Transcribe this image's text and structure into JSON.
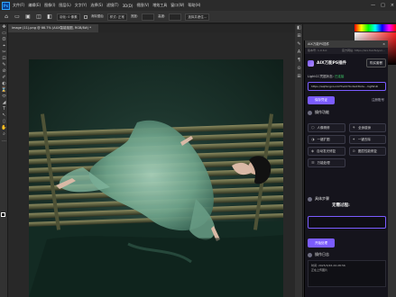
{
  "app": {
    "menu": [
      "文件(F)",
      "编辑(E)",
      "图像(I)",
      "图层(L)",
      "文字(Y)",
      "选择(S)",
      "滤镜(T)",
      "3D(D)",
      "视图(V)",
      "增效工具",
      "窗口(W)",
      "帮助(H)"
    ],
    "window_controls": [
      "—",
      "□",
      "×"
    ]
  },
  "options_bar": {
    "icons": [
      "⌂",
      "▭",
      "▣",
      "◫",
      "◧"
    ],
    "feather_label": "羽化: 0 像素",
    "antialias_label": "消除锯齿",
    "style_label": "样式: 正常",
    "width_label": "宽度:",
    "height_label": "高度:",
    "select_mask_label": "选择并遮住..."
  },
  "document_tab": {
    "title": "image (11).png @ 66.7% (AUX智能抠图, RGB/8#) *"
  },
  "toolbar": {
    "tools": [
      "✥",
      "▭",
      "ʘ",
      "⌖",
      "✂",
      "⊡",
      "✎",
      "⊘",
      "✐",
      "◐",
      "⌛",
      "⬭",
      "◢",
      "T",
      "↖",
      "▯",
      "✋",
      "⌕",
      "…"
    ]
  },
  "dock_icons": [
    "◧",
    "⊞",
    "✎",
    "A",
    "¶",
    "⊙",
    "⊞"
  ],
  "plugin": {
    "title": "AIX万能PS插件",
    "close": "×",
    "version_label": "版本号: 1.0.6.0",
    "website": "官方网站: https://aix.tianfeiyun...",
    "brand_name": "AIX万能PS插件",
    "purchase_button": "购买套餐",
    "credential_label": "LightCC凭据状态: ",
    "credential_status": "已连接",
    "credential_value": "https://aiqfengxiu.lzcf7edd7bc4a23b2a...mgf9n4l",
    "save_button": "保存凭证",
    "register_link": "注册账号",
    "features_title": "操作功能",
    "features": [
      {
        "icon": "⬡",
        "label": "人像精修"
      },
      {
        "icon": "⚘",
        "label": "全身瘦身"
      },
      {
        "icon": "◑",
        "label": "一键扩图"
      },
      {
        "icon": "✦",
        "label": "一键去除"
      },
      {
        "icon": "◈",
        "label": "自动发光修复"
      },
      {
        "icon": "⊙",
        "label": "图层性能修复"
      },
      {
        "icon": "☰",
        "label": "万能处理"
      }
    ],
    "steps_title": "具体步骤",
    "no_steps": "无需过程:",
    "start_button": "开始处理",
    "log_title": "操作日志",
    "log_lines": [
      "时间: 2025/3/26 20:28:56",
      "正在上传图片"
    ]
  },
  "colors": {
    "accent": "#7b5cff",
    "status_ok": "#3fcf6a",
    "ps_blue": "#31a8ff"
  }
}
